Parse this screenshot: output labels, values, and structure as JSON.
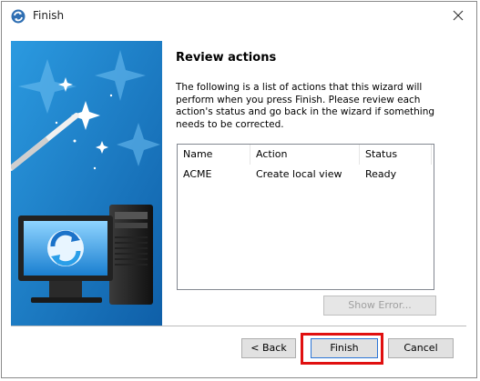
{
  "window": {
    "title": "Finish"
  },
  "page": {
    "heading": "Review actions",
    "description": "The following is a list of actions that this wizard will perform when you press Finish. Please review each action's status and go back in the wizard if something needs to be corrected."
  },
  "actions_table": {
    "columns": [
      "Name",
      "Action",
      "Status"
    ],
    "rows": [
      {
        "name": "ACME",
        "action": "Create local view",
        "status": "Ready"
      }
    ]
  },
  "buttons": {
    "show_error": "Show Error...",
    "back": "< Back",
    "finish": "Finish",
    "cancel": "Cancel"
  },
  "colors": {
    "banner_blue": "#1f86cf",
    "highlight_red": "#e01010"
  }
}
